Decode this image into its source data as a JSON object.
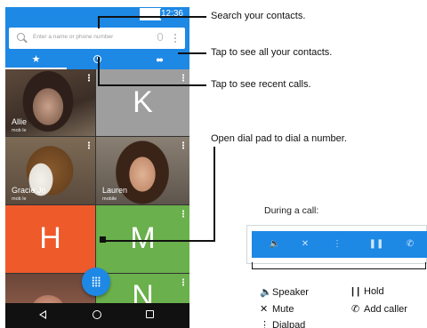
{
  "status": {
    "time": "12:36"
  },
  "search": {
    "placeholder": "Enter a name or phone number"
  },
  "tabs": [
    {
      "name": "favorites",
      "icon": "star-icon",
      "glyph": "★"
    },
    {
      "name": "recents",
      "icon": "clock-icon"
    },
    {
      "name": "contacts",
      "icon": "people-icon",
      "glyph": "👥"
    }
  ],
  "tiles": [
    {
      "name": "Allie",
      "sub": "mob le"
    },
    {
      "letter": "K"
    },
    {
      "name": "Gracie Jo",
      "sub": "mob le"
    },
    {
      "name": "Lauren",
      "sub": "mobile"
    },
    {
      "letter": "H"
    },
    {
      "letter": "M"
    },
    {
      "letter": "N"
    }
  ],
  "callouts": {
    "search": "Search your contacts.",
    "contacts": "Tap to see all your contacts.",
    "recents": "Tap to see recent calls.",
    "dialpad": "Open dial pad to dial a number."
  },
  "during_call": {
    "heading": "During a call:",
    "legend": {
      "speaker": "Speaker",
      "hold": "Hold",
      "mute": "Mute",
      "add_caller": "Add caller",
      "dialpad": "Dialpad"
    }
  },
  "colors": {
    "accent": "#1e88e5",
    "tile_orange": "#ef5a2a",
    "tile_green": "#6ab04c",
    "tile_gray": "#9e9e9e"
  }
}
